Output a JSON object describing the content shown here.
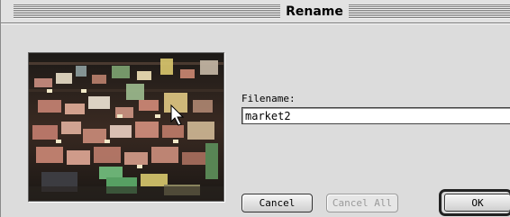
{
  "window": {
    "title": "Rename"
  },
  "form": {
    "filename_label": "Filename:",
    "filename_value": "market2"
  },
  "buttons": {
    "cancel": "Cancel",
    "cancel_all": "Cancel All",
    "ok": "OK"
  },
  "preview": {
    "description_icon": "image-thumbnail-icon"
  },
  "colors": {
    "dialog_bg": "#dcdcdc",
    "disabled_text": "#9a9a9a"
  }
}
